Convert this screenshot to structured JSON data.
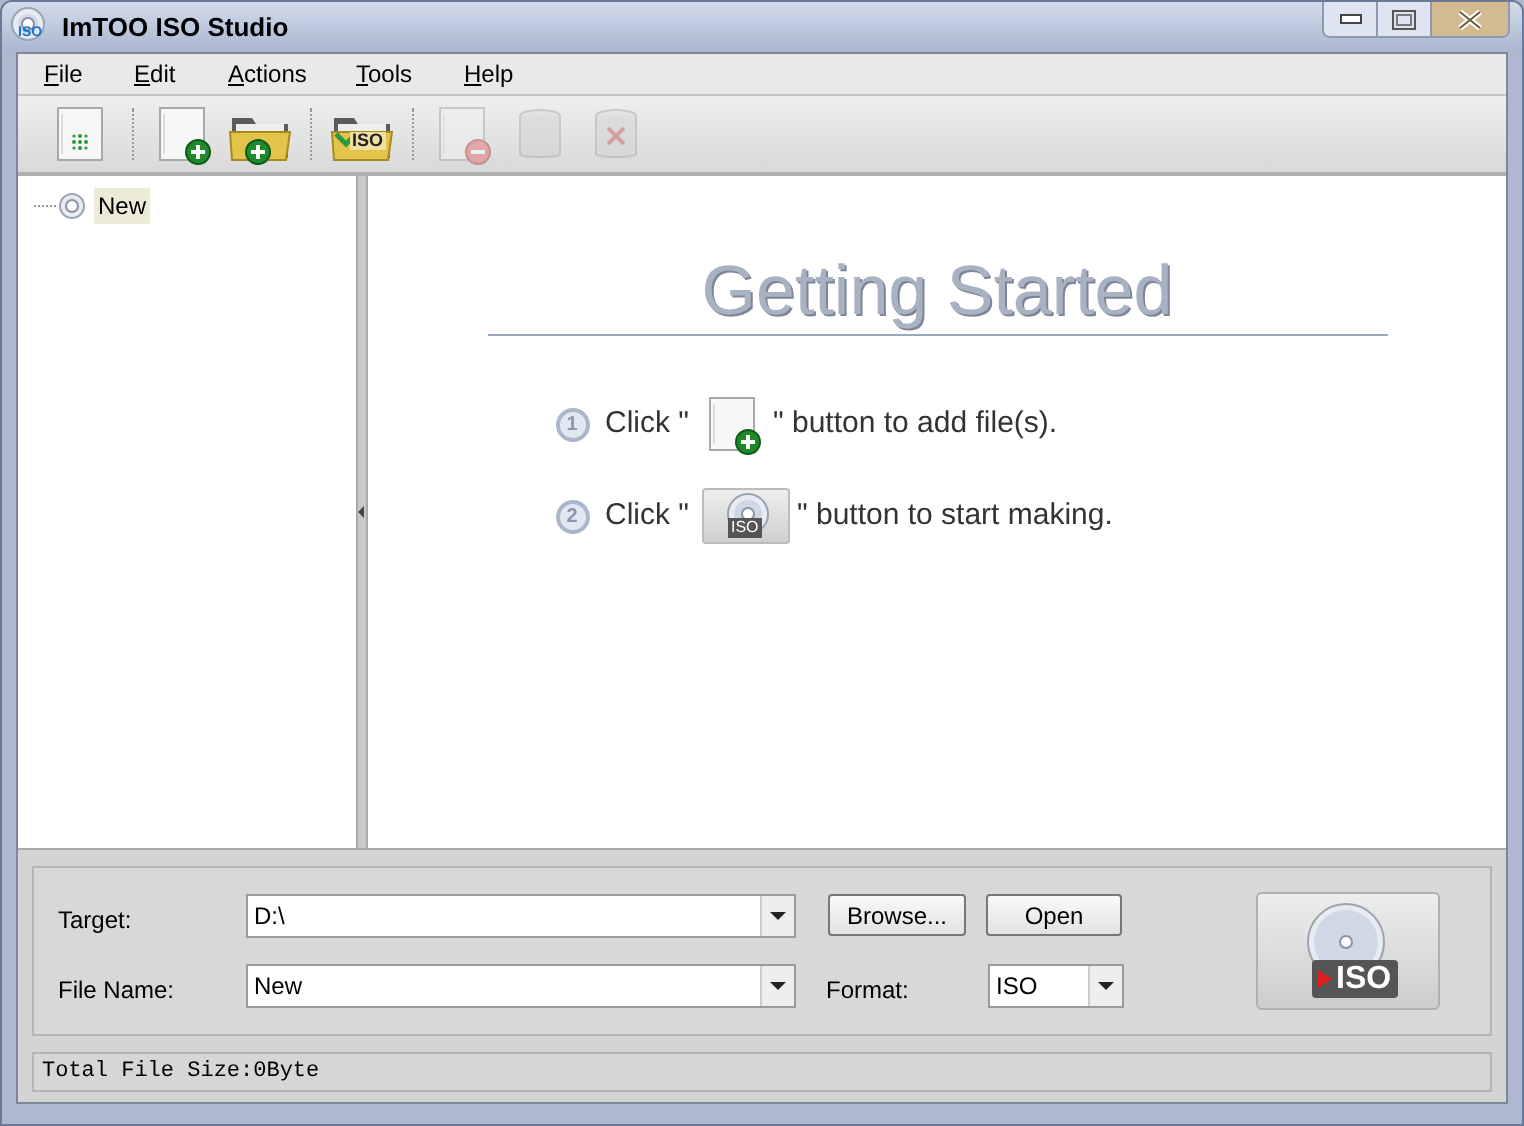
{
  "window": {
    "title": "ImTOO ISO Studio",
    "icon_badge": "ISO"
  },
  "menu": [
    {
      "label": "File"
    },
    {
      "label": "Edit"
    },
    {
      "label": "Actions"
    },
    {
      "label": "Tools"
    },
    {
      "label": "Help"
    }
  ],
  "toolbar": [
    {
      "kind": "new-project",
      "disabled": false
    },
    {
      "kind": "separator"
    },
    {
      "kind": "add-file",
      "disabled": false
    },
    {
      "kind": "add-folder",
      "disabled": false
    },
    {
      "kind": "separator"
    },
    {
      "kind": "import-iso",
      "disabled": false,
      "badge": "ISO"
    },
    {
      "kind": "separator"
    },
    {
      "kind": "remove",
      "disabled": true
    },
    {
      "kind": "clear",
      "disabled": true
    },
    {
      "kind": "delete",
      "disabled": true
    }
  ],
  "tree": [
    {
      "label": "New",
      "selected": true
    }
  ],
  "getting_started": {
    "title": "Getting Started",
    "steps": [
      {
        "number": "1",
        "before": "Click \"",
        "after": "\" button to add file(s)."
      },
      {
        "number": "2",
        "before": "Click \"",
        "after": "\" button to start making.",
        "badge": "ISO"
      }
    ]
  },
  "form": {
    "target": {
      "label": "Target:",
      "value": "D:\\"
    },
    "file_name": {
      "label": "File Name:",
      "value": "New"
    },
    "browse": "Browse...",
    "open": "Open",
    "format": {
      "label": "Format:",
      "value": "ISO"
    }
  },
  "make_button": {
    "badge": "ISO"
  },
  "status_bar": "Total File Size:0Byte"
}
